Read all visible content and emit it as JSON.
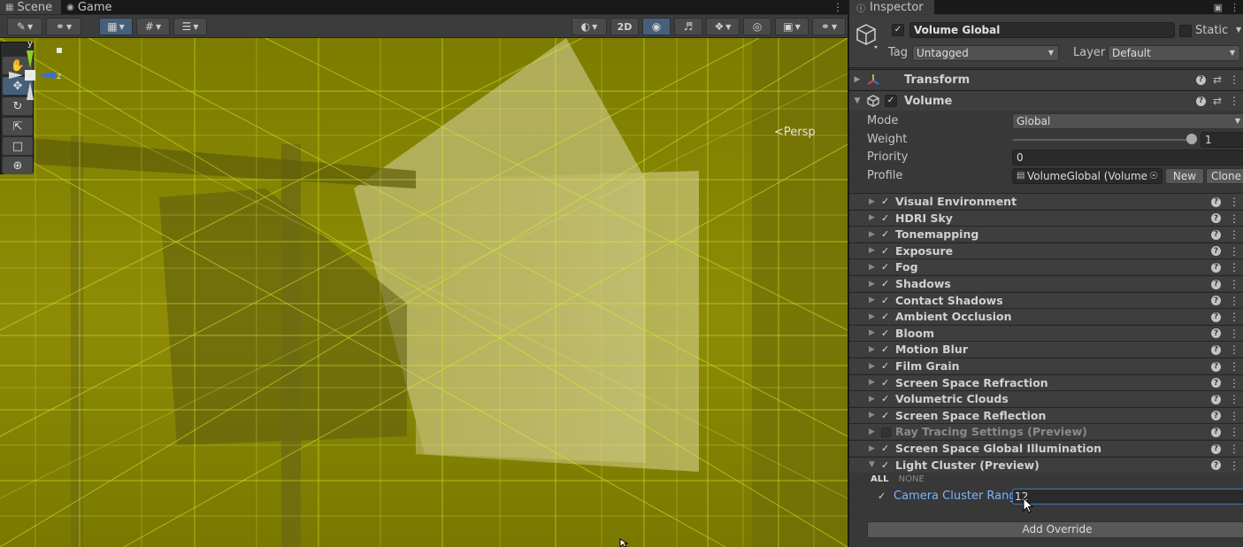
{
  "scene_tabs": [
    {
      "label": "Scene",
      "icon": "grid-icon",
      "active": true
    },
    {
      "label": "Game",
      "icon": "gamepad-icon",
      "active": false
    }
  ],
  "scene_toolbar": {
    "mode_2d_label": "2D"
  },
  "scene_view": {
    "projection_label": "<Persp",
    "gizmo_axes": {
      "y": "y",
      "x": "x",
      "z": "z"
    },
    "colors": {
      "grid": "#d6f02a",
      "tint": "#8a8700"
    }
  },
  "inspector": {
    "tab_label": "Inspector",
    "object": {
      "active": true,
      "name": "Volume Global",
      "static_label": "Static",
      "tag_label": "Tag",
      "tag_value": "Untagged",
      "layer_label": "Layer",
      "layer_value": "Default"
    },
    "components": {
      "transform": {
        "title": "Transform"
      },
      "volume": {
        "title": "Volume",
        "enabled": true,
        "mode_label": "Mode",
        "mode_value": "Global",
        "weight_label": "Weight",
        "weight_value": "1",
        "priority_label": "Priority",
        "priority_value": "0",
        "profile_label": "Profile",
        "profile_value": "VolumeGlobal (Volume",
        "new_label": "New",
        "clone_label": "Clone"
      }
    },
    "overrides": [
      {
        "label": "Visual Environment",
        "enabled": true
      },
      {
        "label": "HDRI Sky",
        "enabled": true
      },
      {
        "label": "Tonemapping",
        "enabled": true
      },
      {
        "label": "Exposure",
        "enabled": true
      },
      {
        "label": "Fog",
        "enabled": true
      },
      {
        "label": "Shadows",
        "enabled": true
      },
      {
        "label": "Contact Shadows",
        "enabled": true
      },
      {
        "label": "Ambient Occlusion",
        "enabled": true
      },
      {
        "label": "Bloom",
        "enabled": true
      },
      {
        "label": "Motion Blur",
        "enabled": true
      },
      {
        "label": "Film Grain",
        "enabled": true
      },
      {
        "label": "Screen Space Refraction",
        "enabled": true
      },
      {
        "label": "Volumetric Clouds",
        "enabled": true
      },
      {
        "label": "Screen Space Reflection",
        "enabled": true
      },
      {
        "label": "Ray Tracing Settings (Preview)",
        "enabled": false
      },
      {
        "label": "Screen Space Global Illumination",
        "enabled": true
      },
      {
        "label": "Light Cluster (Preview)",
        "enabled": true,
        "expanded": true
      }
    ],
    "light_cluster": {
      "all_label": "ALL",
      "none_label": "NONE",
      "camera_cluster_range_label": "Camera Cluster Range",
      "camera_cluster_range_value": "12"
    },
    "add_override_label": "Add Override"
  }
}
